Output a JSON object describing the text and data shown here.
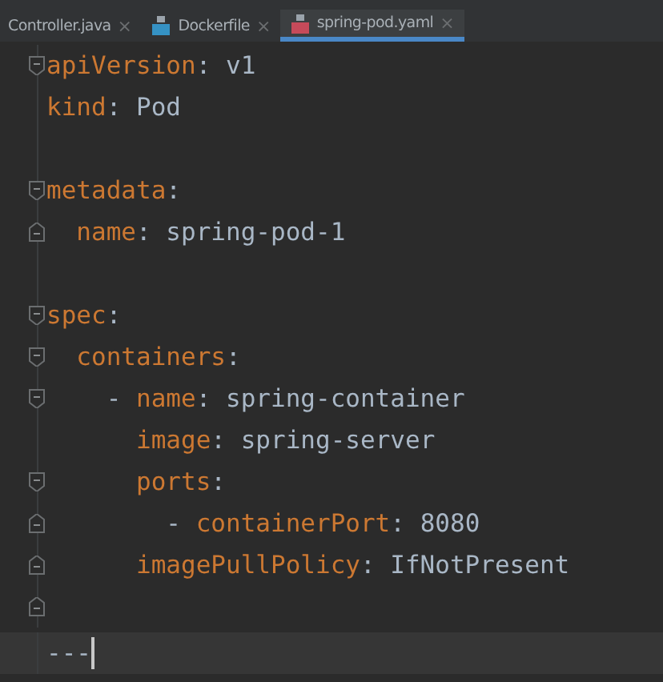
{
  "tabs": [
    {
      "label": "Controller.java",
      "kind": "plain",
      "close": "×",
      "selected": false
    },
    {
      "label": "Dockerfile",
      "kind": "docker",
      "close": "×",
      "selected": false
    },
    {
      "label": "spring-pod.yaml",
      "kind": "yaml",
      "close": "×",
      "selected": true
    }
  ],
  "lines": [
    {
      "kind": "code",
      "text": "apiVersion: v1",
      "fold_start": true,
      "fold_end": false,
      "current": false
    },
    {
      "kind": "code",
      "text": "kind: Pod",
      "fold_start": false,
      "fold_end": false,
      "current": false
    },
    {
      "kind": "blank",
      "fold_start": false,
      "fold_end": false
    },
    {
      "kind": "code",
      "text": "metadata:",
      "fold_start": true,
      "fold_end": false,
      "current": false
    },
    {
      "kind": "code",
      "text": "  name: spring-pod-1",
      "fold_start": false,
      "fold_end": true,
      "current": false
    },
    {
      "kind": "blank",
      "fold_start": false,
      "fold_end": false
    },
    {
      "kind": "code",
      "text": "spec:",
      "fold_start": true,
      "fold_end": false,
      "current": false
    },
    {
      "kind": "code",
      "text": "  containers:",
      "fold_start": true,
      "fold_end": false,
      "current": false
    },
    {
      "kind": "code",
      "text": "    - name: spring-container",
      "fold_start": true,
      "fold_end": false,
      "current": false
    },
    {
      "kind": "code",
      "text": "      image: spring-server",
      "fold_start": false,
      "fold_end": false,
      "current": false
    },
    {
      "kind": "code",
      "text": "      ports:",
      "fold_start": true,
      "fold_end": false,
      "current": false
    },
    {
      "kind": "code",
      "text": "        - containerPort: 8080",
      "fold_start": false,
      "fold_end": true,
      "current": false
    },
    {
      "kind": "code",
      "text": "      imagePullPolicy: IfNotPresent",
      "fold_start": false,
      "fold_end": true,
      "current": false
    },
    {
      "kind": "blank",
      "fold_start": false,
      "fold_end": true
    },
    {
      "kind": "code",
      "text": "---",
      "fold_start": false,
      "fold_end": false,
      "current": true
    }
  ]
}
